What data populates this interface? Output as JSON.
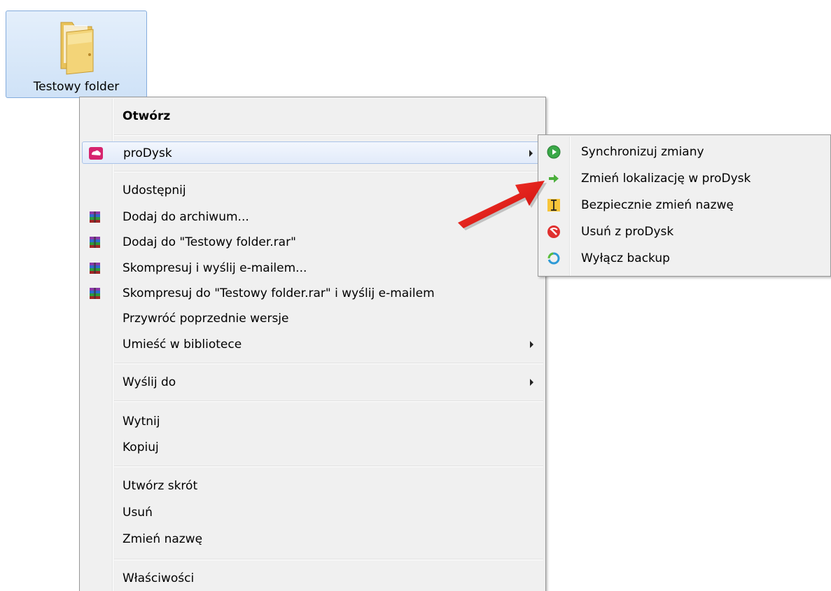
{
  "folder": {
    "label": "Testowy folder"
  },
  "context_menu": {
    "items": [
      {
        "label": "Otwórz",
        "bold": true
      },
      {
        "label": "proDysk",
        "icon": "prodysk-icon",
        "submenu": true,
        "highlighted": true
      },
      {
        "label": "Udostępnij"
      },
      {
        "label": "Dodaj do archiwum...",
        "icon": "winrar-icon"
      },
      {
        "label": "Dodaj do \"Testowy folder.rar\"",
        "icon": "winrar-icon"
      },
      {
        "label": "Skompresuj i wyślij e-mailem...",
        "icon": "winrar-icon"
      },
      {
        "label": "Skompresuj do \"Testowy folder.rar\" i wyślij e-mailem",
        "icon": "winrar-icon"
      },
      {
        "label": "Przywróć poprzednie wersje"
      },
      {
        "label": "Umieść w bibliotece",
        "submenu": true
      },
      {
        "label": "Wyślij do",
        "submenu": true
      },
      {
        "label": "Wytnij"
      },
      {
        "label": "Kopiuj"
      },
      {
        "label": "Utwórz skrót"
      },
      {
        "label": "Usuń"
      },
      {
        "label": "Zmień nazwę"
      },
      {
        "label": "Właściwości"
      }
    ]
  },
  "submenu": {
    "items": [
      {
        "label": "Synchronizuj zmiany",
        "icon": "sync-play-icon"
      },
      {
        "label": "Zmień lokalizację w proDysk",
        "icon": "move-arrow-icon"
      },
      {
        "label": "Bezpiecznie zmień nazwę",
        "icon": "rename-cursor-icon"
      },
      {
        "label": "Usuń z proDysk",
        "icon": "remove-icon"
      },
      {
        "label": "Wyłącz backup",
        "icon": "backup-off-icon"
      }
    ]
  },
  "colors": {
    "menu_background": "#f0f0f0",
    "highlight_border": "#a9c3e8",
    "annotation_arrow": "#e21515",
    "prodysk_brand": "#d6246e"
  }
}
